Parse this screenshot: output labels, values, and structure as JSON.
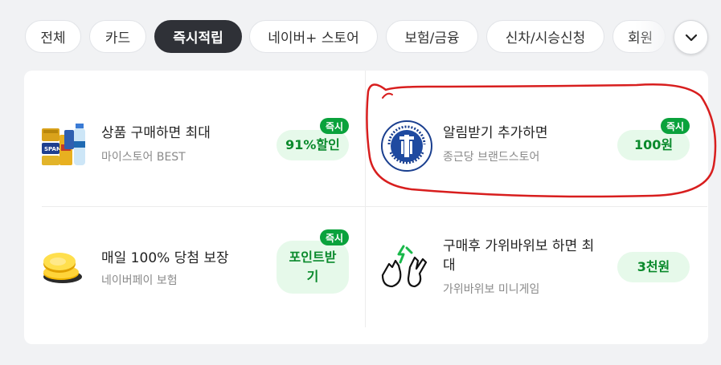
{
  "tabs": [
    {
      "label": "전체"
    },
    {
      "label": "카드"
    },
    {
      "label": "즉시적립"
    },
    {
      "label": "네이버+ 스토어"
    },
    {
      "label": "보험/금융"
    },
    {
      "label": "신차/시승신청"
    },
    {
      "label": "회원"
    }
  ],
  "active_tab": "즉시적립",
  "offers": [
    {
      "title": "상품 구매하면 최대",
      "subtitle": "마이스토어 BEST",
      "reward": "91%할인",
      "badge": "즉시",
      "icon": "grocery-products-icon"
    },
    {
      "title": "알림받기 추가하면",
      "subtitle": "종근당 브랜드스토어",
      "reward": "100원",
      "badge": "즉시",
      "icon": "chong-kun-dang-logo"
    },
    {
      "title": "매일 100% 당첨 보장",
      "subtitle": "네이버페이 보험",
      "reward": "포인트받기",
      "badge": "즉시",
      "icon": "gold-coins-icon"
    },
    {
      "title": "구매후 가위바위보 하면 최대",
      "subtitle": "가위바위보 미니게임",
      "reward": "3천원",
      "icon": "rock-paper-scissors-icon"
    }
  ],
  "logo_text": "SEE THROUGH SOLVE THROUGH · Chong Kun Dang",
  "colors": {
    "accent_green": "#0aa23c",
    "reward_bg": "#e6f9ea",
    "active_chip": "#2f3137",
    "annotation_red": "#d81e1e"
  }
}
